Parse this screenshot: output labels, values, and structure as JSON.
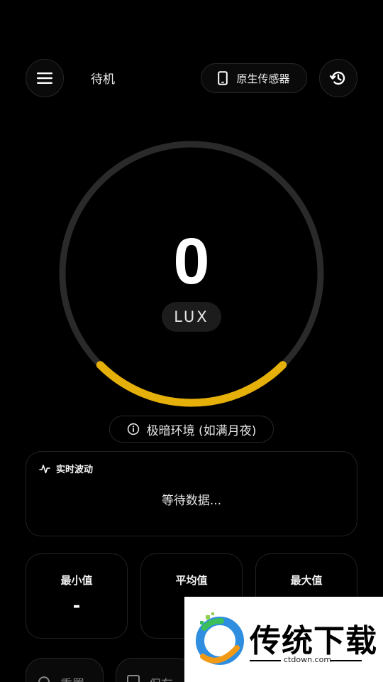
{
  "header": {
    "status": "待机",
    "sensor_label": "原生传感器",
    "menu_icon": "menu-icon",
    "history_icon": "history-icon",
    "phone_icon": "phone-icon"
  },
  "gauge": {
    "value": "0",
    "unit": "LUX",
    "fill_fraction": 0.25,
    "track_color": "#2a2a2a",
    "accent_color": "#e6b00a"
  },
  "environment": {
    "label": "极暗环境 (如满月夜)",
    "icon": "info-icon"
  },
  "live": {
    "title": "实时波动",
    "icon": "pulse-icon",
    "empty_text": "等待数据..."
  },
  "stats": {
    "min_label": "最小值",
    "min_value": "-",
    "avg_label": "平均值",
    "max_label": "最大值"
  },
  "actions": {
    "reset_label": "重置",
    "save_label": "保存"
  },
  "watermark": {
    "title": "传统下载",
    "site": "ctdown.com"
  }
}
